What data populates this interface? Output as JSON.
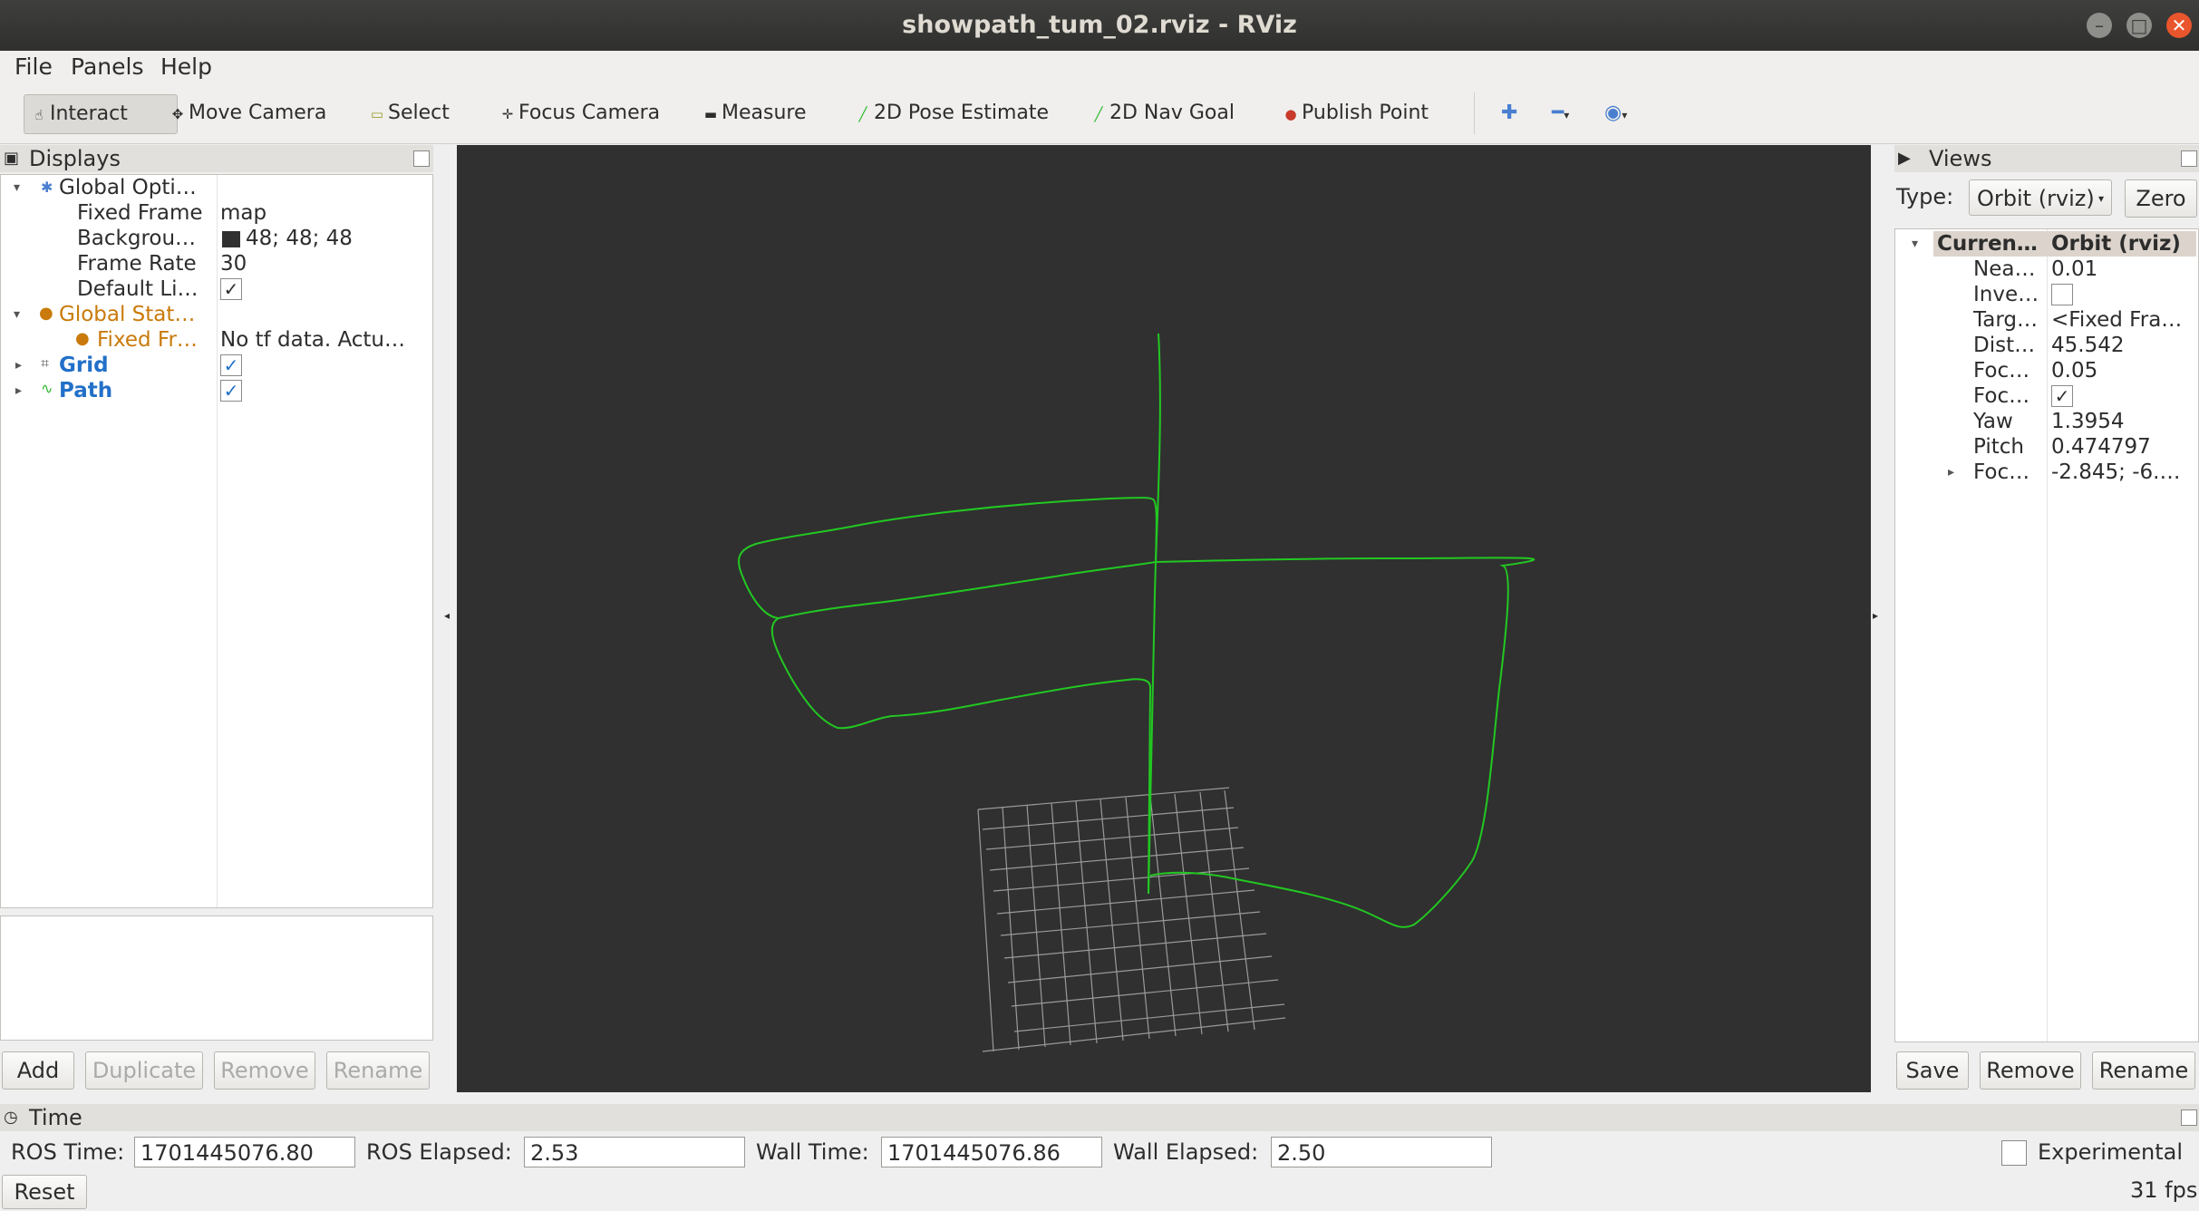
{
  "window": {
    "title": "showpath_tum_02.rviz - RViz"
  },
  "menu": [
    "File",
    "Panels",
    "Help"
  ],
  "toolbar": {
    "tools": [
      {
        "label": "Interact",
        "icon": "hand-icon"
      },
      {
        "label": "Move Camera",
        "icon": "move-icon"
      },
      {
        "label": "Select",
        "icon": "select-icon"
      },
      {
        "label": "Focus Camera",
        "icon": "focus-icon"
      },
      {
        "label": "Measure",
        "icon": "ruler-icon"
      },
      {
        "label": "2D Pose Estimate",
        "icon": "pose-arrow-icon"
      },
      {
        "label": "2D Nav Goal",
        "icon": "nav-arrow-icon"
      },
      {
        "label": "Publish Point",
        "icon": "pin-icon"
      }
    ]
  },
  "displays": {
    "title": "Displays",
    "rows": {
      "global_options": "Global Opti…",
      "fixed_frame_label": "Fixed Frame",
      "fixed_frame_value": "map",
      "background_label": "Backgrou…",
      "background_value": "48; 48; 48",
      "frame_rate_label": "Frame Rate",
      "frame_rate_value": "30",
      "default_light_label": "Default Li…",
      "global_status": "Global Stat…",
      "fixed_fr_label": "Fixed Fr…",
      "fixed_fr_value": "No tf data.  Actu…",
      "grid_label": "Grid",
      "path_label": "Path"
    },
    "buttons": {
      "add": "Add",
      "duplicate": "Duplicate",
      "remove": "Remove",
      "rename": "Rename"
    }
  },
  "views": {
    "title": "Views",
    "type_label": "Type:",
    "type_value": "Orbit (rviz)",
    "zero": "Zero",
    "header_name": "Curren…",
    "header_value": "Orbit (rviz)",
    "props": [
      {
        "name": "Nea…",
        "value": "0.01"
      },
      {
        "name": "Inve…",
        "value": ""
      },
      {
        "name": "Targ…",
        "value": "<Fixed Fra…"
      },
      {
        "name": "Dist…",
        "value": "45.542"
      },
      {
        "name": "Foc…",
        "value": "0.05"
      },
      {
        "name": "Foc…",
        "value": ""
      },
      {
        "name": "Yaw",
        "value": "1.3954"
      },
      {
        "name": "Pitch",
        "value": "0.474797"
      },
      {
        "name": "Foc…",
        "value": "-2.845; -6.…"
      }
    ],
    "buttons": {
      "save": "Save",
      "remove": "Remove",
      "rename": "Rename"
    }
  },
  "time": {
    "title": "Time",
    "ros_time_label": "ROS Time:",
    "ros_time": "1701445076.80",
    "ros_elapsed_label": "ROS Elapsed:",
    "ros_elapsed": "2.53",
    "wall_time_label": "Wall Time:",
    "wall_time": "1701445076.86",
    "wall_elapsed_label": "Wall Elapsed:",
    "wall_elapsed": "2.50",
    "experimental": "Experimental",
    "reset": "Reset",
    "fps": "31 fps"
  },
  "colors": {
    "viewport_bg": "#303030",
    "path": "#22c822",
    "grid": "#a0a0a0"
  }
}
